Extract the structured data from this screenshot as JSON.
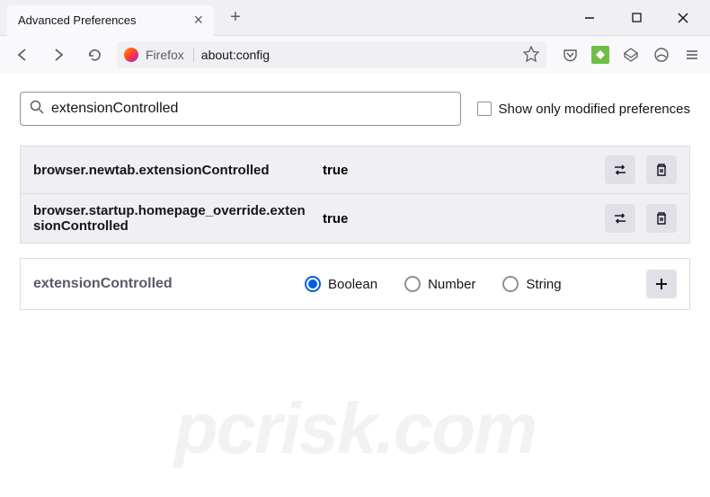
{
  "tab": {
    "title": "Advanced Preferences"
  },
  "url": {
    "firefox_label": "Firefox",
    "address": "about:config"
  },
  "search": {
    "value": "extensionControlled",
    "checkbox_label": "Show only modified preferences"
  },
  "prefs": [
    {
      "name": "browser.newtab.extensionControlled",
      "value": "true"
    },
    {
      "name": "browser.startup.homepage_override.extensionControlled",
      "value": "true"
    }
  ],
  "add": {
    "name": "extensionControlled",
    "types": {
      "boolean": "Boolean",
      "number": "Number",
      "string": "String"
    }
  },
  "watermark": "pcrisk.com"
}
